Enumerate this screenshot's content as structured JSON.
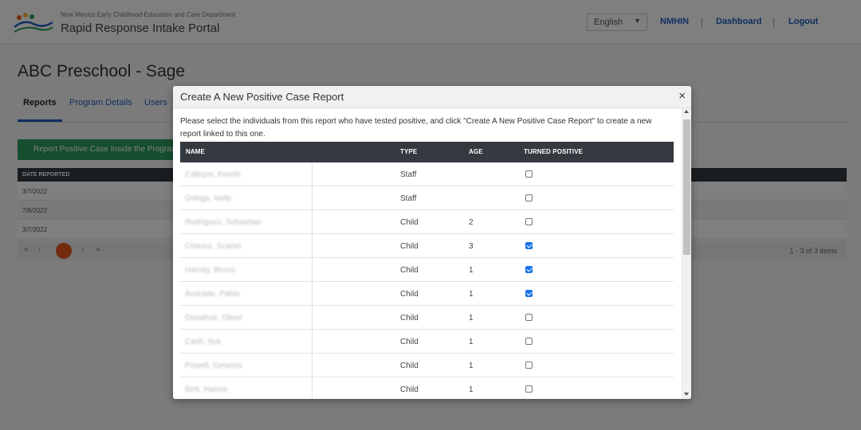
{
  "header": {
    "org_name": "New Mexico Early Childhood Education and Care Department",
    "portal_name": "Rapid Response Intake Portal",
    "language": "English",
    "nav": [
      "NMHIN",
      "Dashboard",
      "Logout"
    ]
  },
  "page": {
    "title": "ABC Preschool - Sage",
    "tabs": [
      "Reports",
      "Program Details",
      "Users"
    ],
    "report_button": "Report Positive Case Inside the Program",
    "table_header": "DATE REPORTED",
    "rows": [
      "3/7/2022",
      "7/8/2022",
      "3/7/2022"
    ],
    "pagination_info": "1 - 3 of 3 items"
  },
  "modal": {
    "title": "Create A New Positive Case Report",
    "close_glyph": "×",
    "intro": "Please select the individuals from this report who have tested positive, and click \"Create A New Positive Case Report\" to create a new report linked to this one.",
    "columns": {
      "name": "NAME",
      "type": "TYPE",
      "age": "AGE",
      "turned_positive": "TURNED POSITIVE"
    },
    "rows": [
      {
        "name": "Callejos, Keesh",
        "type": "Staff",
        "age": "",
        "positive": false
      },
      {
        "name": "Ortega, Nelly",
        "type": "Staff",
        "age": "",
        "positive": false
      },
      {
        "name": "Rodriguez, Sebastian",
        "type": "Child",
        "age": "2",
        "positive": false
      },
      {
        "name": "Chavez, Scarlet",
        "type": "Child",
        "age": "3",
        "positive": true
      },
      {
        "name": "Harvey, Bruno",
        "type": "Child",
        "age": "1",
        "positive": true
      },
      {
        "name": "Andrade, Pablo",
        "type": "Child",
        "age": "1",
        "positive": true
      },
      {
        "name": "Donahue, Oliver",
        "type": "Child",
        "age": "1",
        "positive": false
      },
      {
        "name": "Cash, Ilya",
        "type": "Child",
        "age": "1",
        "positive": false
      },
      {
        "name": "Powell, Genesis",
        "type": "Child",
        "age": "1",
        "positive": false
      },
      {
        "name": "Bett, Hanna",
        "type": "Child",
        "age": "1",
        "positive": false
      }
    ]
  }
}
